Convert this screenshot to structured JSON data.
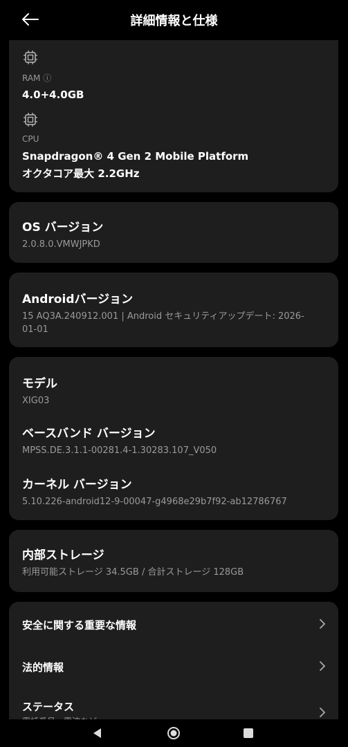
{
  "header": {
    "title": "詳細情報と仕様"
  },
  "specs": {
    "ram": {
      "label": "RAM ⓘ",
      "value": "4.0+4.0GB"
    },
    "cpu": {
      "label": "CPU",
      "value_line1": "Snapdragon® 4 Gen 2 Mobile Platform",
      "value_line2": "オクタコア最大 2.2GHz"
    }
  },
  "os_version": {
    "title": "OS バージョン",
    "value": "2.0.8.0.VMWJPKD"
  },
  "android_version": {
    "title": "Androidバージョン",
    "value": "15 AQ3A.240912.001 | Android セキュリティアップデート: 2026-01-01"
  },
  "device": {
    "model": {
      "title": "モデル",
      "value": "XIG03"
    },
    "baseband": {
      "title": "ベースバンド バージョン",
      "value": "MPSS.DE.3.1.1-00281.4-1.30283.107_V050"
    },
    "kernel": {
      "title": "カーネル バージョン",
      "value": "5.10.226-android12-9-00047-g4968e29b7f92-ab12786767"
    }
  },
  "storage": {
    "title": "内部ストレージ",
    "value": "利用可能ストレージ  34.5GB / 合計ストレージ  128GB"
  },
  "links": [
    {
      "label": "安全に関する重要な情報"
    },
    {
      "label": "法的情報"
    },
    {
      "label": "ステータス",
      "sub": "電話番号、電波など"
    }
  ],
  "icons": {
    "back": "arrow-left-icon",
    "chip": "chip-icon",
    "chevron": "chevron-right-icon",
    "nav": [
      "nav-back-icon",
      "nav-home-icon",
      "nav-recents-icon"
    ]
  }
}
